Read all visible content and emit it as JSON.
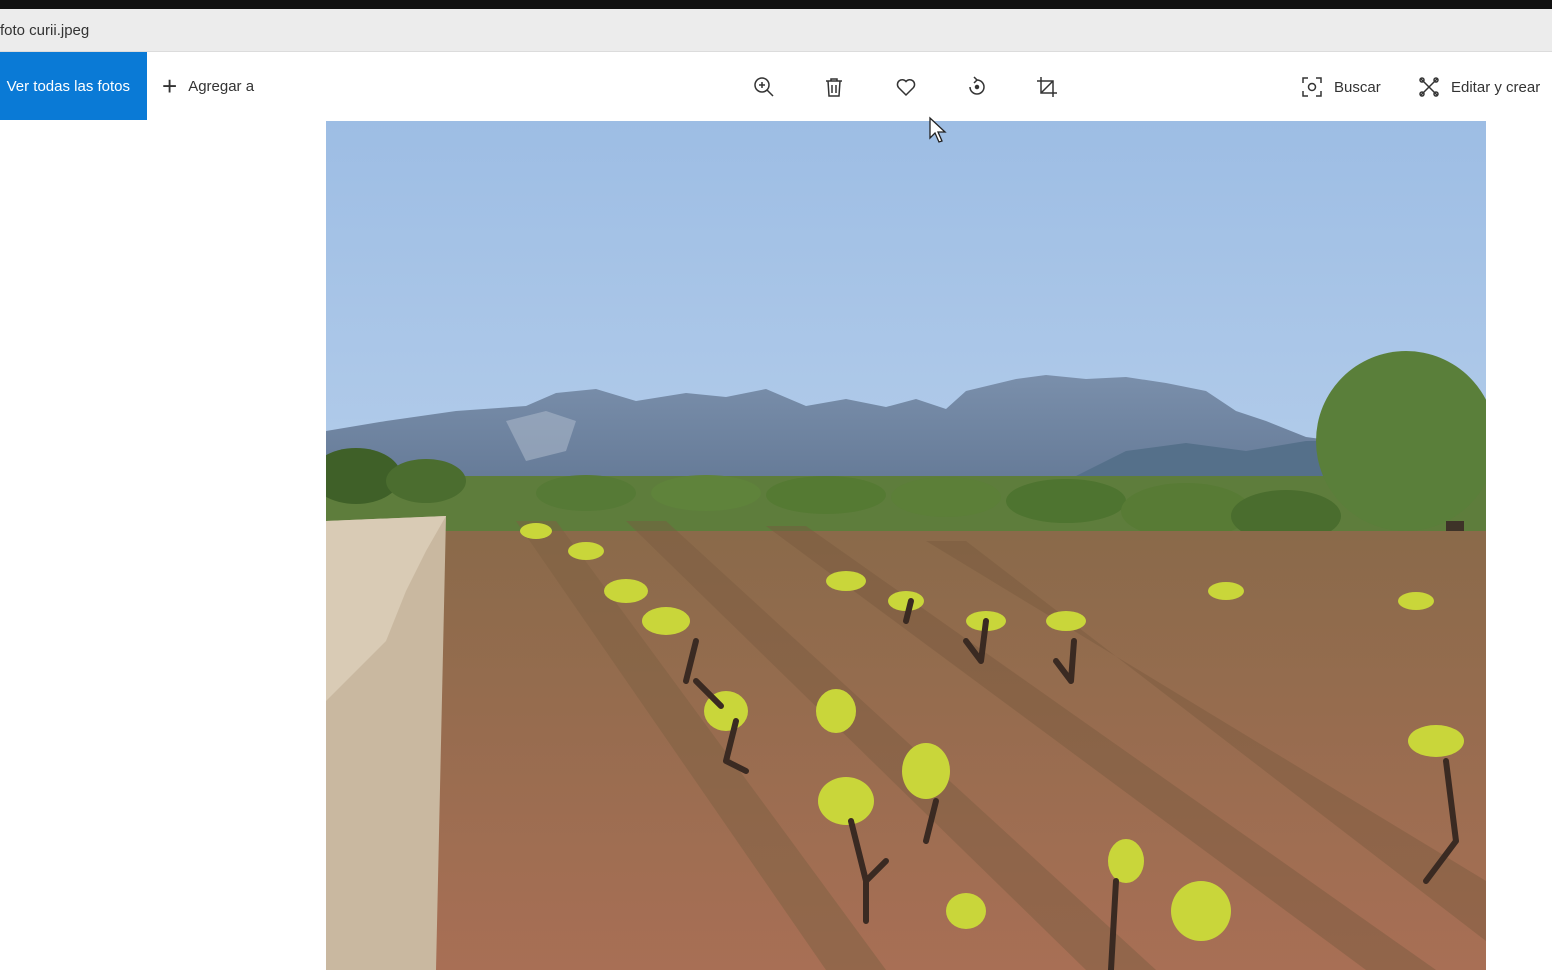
{
  "window": {
    "title": "foto curii.jpeg"
  },
  "toolbar": {
    "view_all_label": "Ver todas las fotos",
    "add_to_label": "Agregar a",
    "search_label": "Buscar",
    "edit_create_label": "Editar y crear",
    "icons": [
      "zoom-icon",
      "delete-icon",
      "favorite-icon",
      "rotate-icon",
      "crop-icon",
      "search-lens-icon",
      "edit-create-icon"
    ]
  },
  "photo": {
    "subject": "vineyard-with-mountains"
  },
  "colors": {
    "accent": "#0a7ad6",
    "sky_top": "#9dbde4",
    "sky_bottom": "#cfe0f2",
    "mountains": "#7e92ad",
    "soil": "#9a6a4e",
    "foliage": "#c9d63a",
    "trees": "#4f7a34"
  }
}
